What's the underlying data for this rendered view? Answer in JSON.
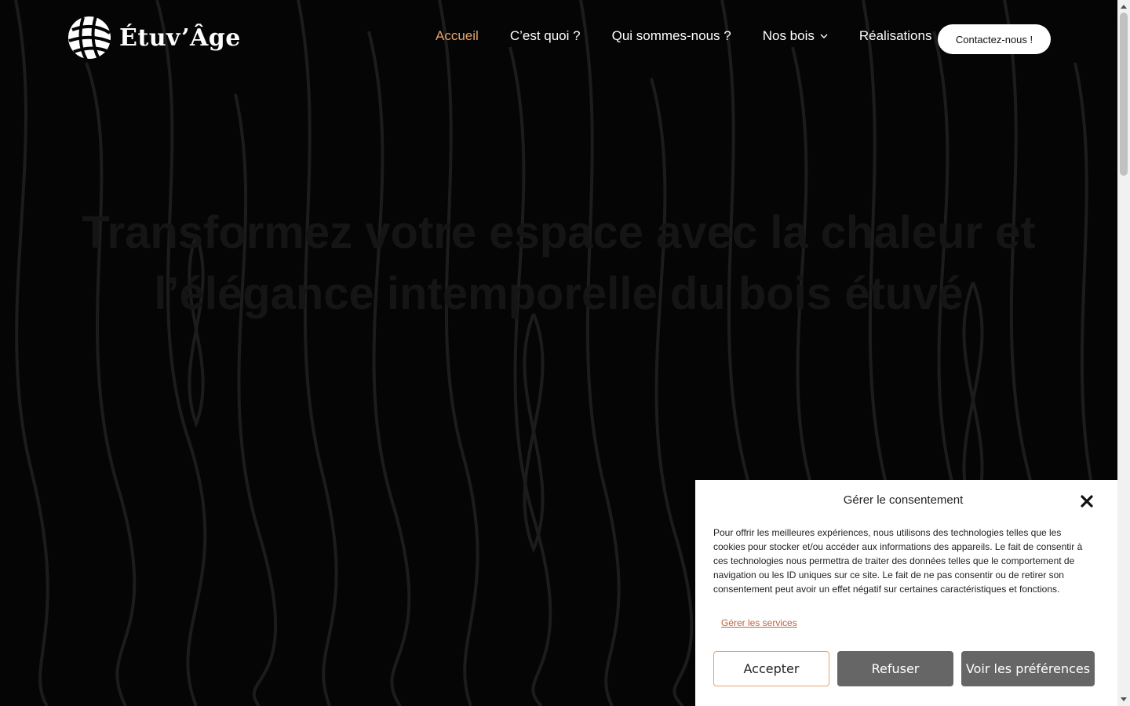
{
  "header": {
    "logo_text": "Étuv’Âge",
    "nav": [
      {
        "label": "Accueil",
        "active": true
      },
      {
        "label": "C’est quoi ?",
        "active": false
      },
      {
        "label": "Qui sommes-nous ?",
        "active": false
      },
      {
        "label": "Nos bois",
        "active": false,
        "has_dropdown": true
      },
      {
        "label": "Réalisations",
        "active": false
      }
    ],
    "cta_label": "Contactez-nous !"
  },
  "hero": {
    "title": "Transformez votre espace avec la chaleur et l’élégance intemporelle du bois étuvé"
  },
  "consent": {
    "title": "Gérer le consentement",
    "text": "Pour offrir les meilleures expériences, nous utilisons des technologies telles que les cookies pour stocker et/ou accéder aux informations des appareils. Le fait de consentir à ces technologies nous permettra de traiter des données telles que le comportement de navigation ou les ID uniques sur ce site. Le fait de ne pas consentir ou de retirer son consentement peut avoir un effet négatif sur certaines caractéristiques et fonctions.",
    "manage_link": "Gérer les services",
    "accept_label": "Accepter",
    "refuse_label": "Refuser",
    "prefs_label": "Voir les préférences"
  },
  "colors": {
    "accent": "#e8a36b",
    "background": "#050505",
    "button_grey": "#666666",
    "link": "#c0623a"
  },
  "icons": [
    "globe-logo-icon",
    "chevron-down-icon",
    "close-icon",
    "scroll-up-arrow-icon",
    "scroll-down-arrow-icon"
  ]
}
